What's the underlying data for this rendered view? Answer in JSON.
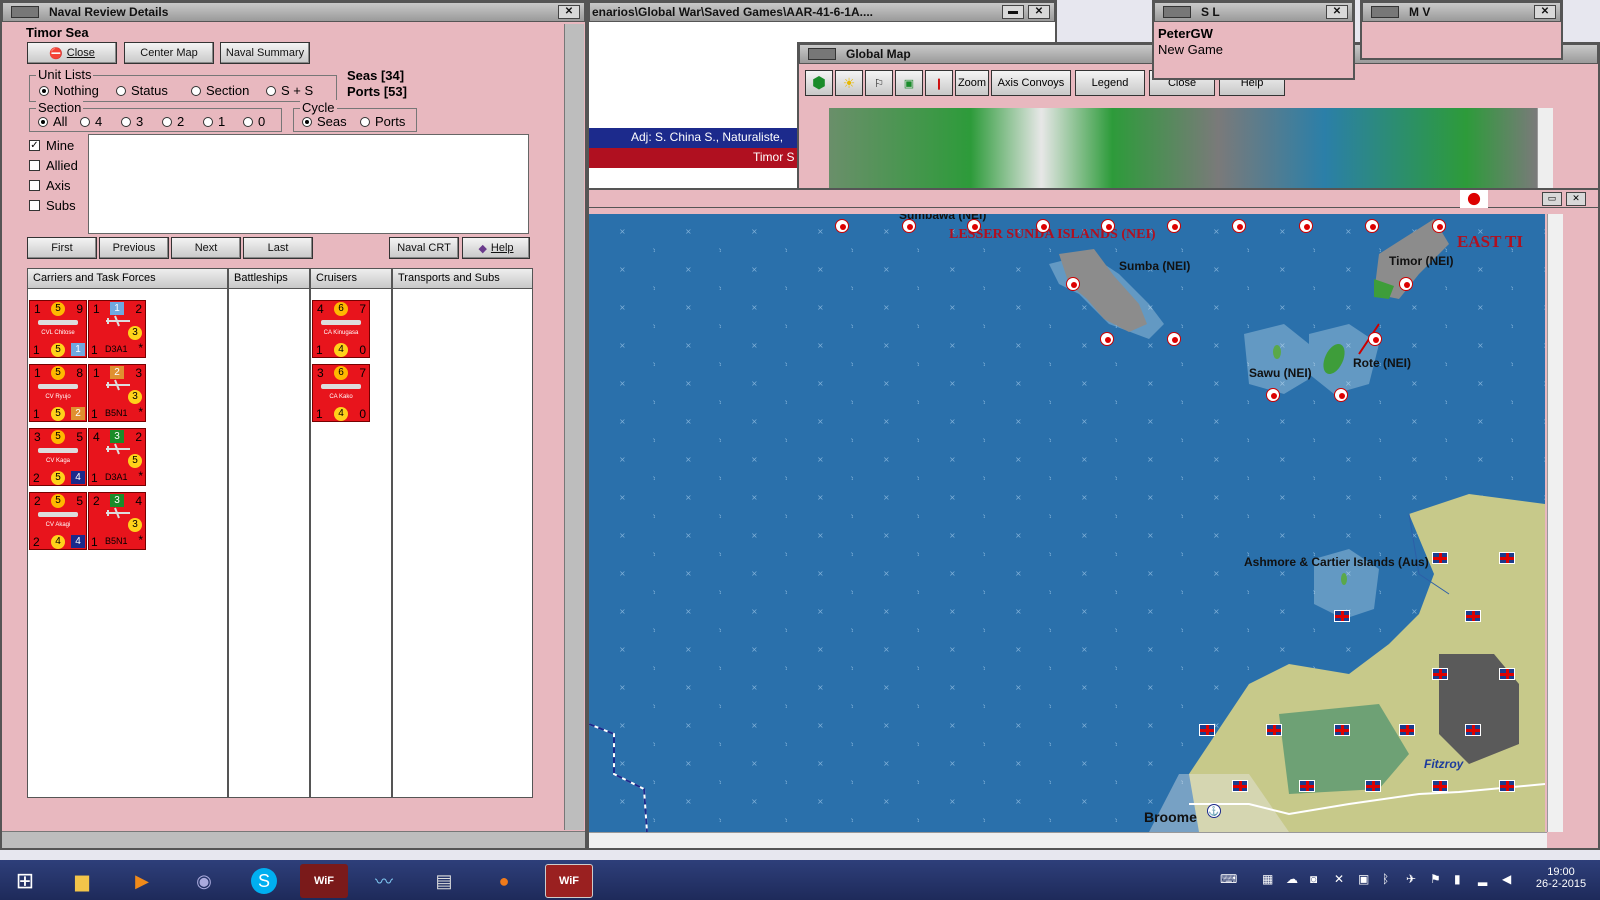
{
  "naval_window": {
    "title": "Naval Review Details",
    "sea_name": "Timor Sea",
    "buttons": {
      "close": "Close",
      "center_map": "Center Map",
      "naval_summary": "Naval Summary"
    },
    "unit_lists": {
      "label": "Unit Lists",
      "options": [
        "Nothing",
        "Status",
        "Section",
        "S + S"
      ],
      "selected": "Nothing"
    },
    "counts": {
      "seas": "Seas [34]",
      "ports": "Ports [53]"
    },
    "section": {
      "label": "Section",
      "options": [
        "All",
        "4",
        "3",
        "2",
        "1",
        "0"
      ],
      "selected": "All"
    },
    "cycle": {
      "label": "Cycle",
      "options": [
        "Seas",
        "Ports"
      ],
      "selected": "Seas"
    },
    "filters": [
      {
        "label": "Mine",
        "checked": true
      },
      {
        "label": "Allied",
        "checked": false
      },
      {
        "label": "Axis",
        "checked": false
      },
      {
        "label": "Subs",
        "checked": false
      }
    ],
    "nav_buttons": {
      "first": "First",
      "previous": "Previous",
      "next": "Next",
      "last": "Last",
      "naval_crt": "Naval CRT",
      "help": "Help"
    },
    "columns": [
      "Carriers and Task Forces",
      "Battleships",
      "Cruisers",
      "Transports and Subs"
    ],
    "carriers": [
      {
        "ship": {
          "tl": "1",
          "mid": "5",
          "tr": "9",
          "bl": "1",
          "bc": "5",
          "br": "1",
          "name": "CVL Chitose",
          "brc": "#6fa8e0"
        },
        "air": {
          "tl": "1",
          "mid": "1",
          "tr": "2",
          "bl": "1",
          "bc": "3",
          "br": "*",
          "name": "D3A1",
          "midc": "#6fa8e0"
        }
      },
      {
        "ship": {
          "tl": "1",
          "mid": "5",
          "tr": "8",
          "bl": "1",
          "bc": "5",
          "br": "2",
          "name": "CV Ryujo",
          "brc": "#e09030"
        },
        "air": {
          "tl": "1",
          "mid": "2",
          "tr": "3",
          "bl": "1",
          "bc": "3",
          "br": "*",
          "name": "B5N1",
          "midc": "#e09030"
        }
      },
      {
        "ship": {
          "tl": "3",
          "mid": "5",
          "tr": "5",
          "bl": "2",
          "bc": "5",
          "br": "4",
          "name": "CV Kaga",
          "brc": "#1a2a8c"
        },
        "air": {
          "tl": "4",
          "mid": "3",
          "tr": "2",
          "bl": "1",
          "bc": "5",
          "br": "*",
          "name": "D3A1",
          "midc": "#1a8c2a"
        }
      },
      {
        "ship": {
          "tl": "2",
          "mid": "5",
          "tr": "5",
          "bl": "2",
          "bc": "4",
          "br": "4",
          "name": "CV Akagi",
          "brc": "#1a2a8c"
        },
        "air": {
          "tl": "2",
          "mid": "3",
          "tr": "4",
          "bl": "1",
          "bc": "3",
          "br": "*",
          "name": "B5N1",
          "midc": "#1a8c2a"
        }
      }
    ],
    "cruisers": [
      {
        "tl": "4",
        "mid": "6",
        "tr": "7",
        "bl": "1",
        "bc": "4",
        "br": "0",
        "name": "CA Kinugasa"
      },
      {
        "tl": "3",
        "mid": "6",
        "tr": "7",
        "bl": "1",
        "bc": "4",
        "br": "0",
        "name": "CA Kako"
      }
    ]
  },
  "file_window": {
    "title": "enarios\\Global War\\Saved Games\\AAR-41-6-1A....",
    "adj": "Adj: S. China S., Naturaliste,",
    "timor": "Timor S"
  },
  "global_map": {
    "title": "Global Map",
    "tools": [
      "Zoom",
      "Axis Convoys",
      "Legend",
      "Close",
      "Help"
    ]
  },
  "sl_window": {
    "title": "S L",
    "player": "PeterGW",
    "status": "New Game"
  },
  "mv_window": {
    "title": "M V"
  },
  "map_labels": {
    "sumbawa": "Sumbawa (NEI)",
    "lesser_sunda": "LESSER SUNDA ISLANDS (NEI)",
    "east": "EAST TI",
    "sumba": "Sumba (NEI)",
    "timor": "Timor (NEI)",
    "sawu": "Sawu (NEI)",
    "rote": "Rote (NEI)",
    "ashmore": "Ashmore & Cartier Islands (Aus)",
    "fitzroy": "Fitzroy",
    "broome": "Broome"
  },
  "taskbar": {
    "time": "19:00",
    "date": "26-2-2015"
  },
  "colors": {
    "sea": "#2a70ab",
    "counter_red": "#e8141c",
    "window_pink": "#e8b8bf"
  }
}
